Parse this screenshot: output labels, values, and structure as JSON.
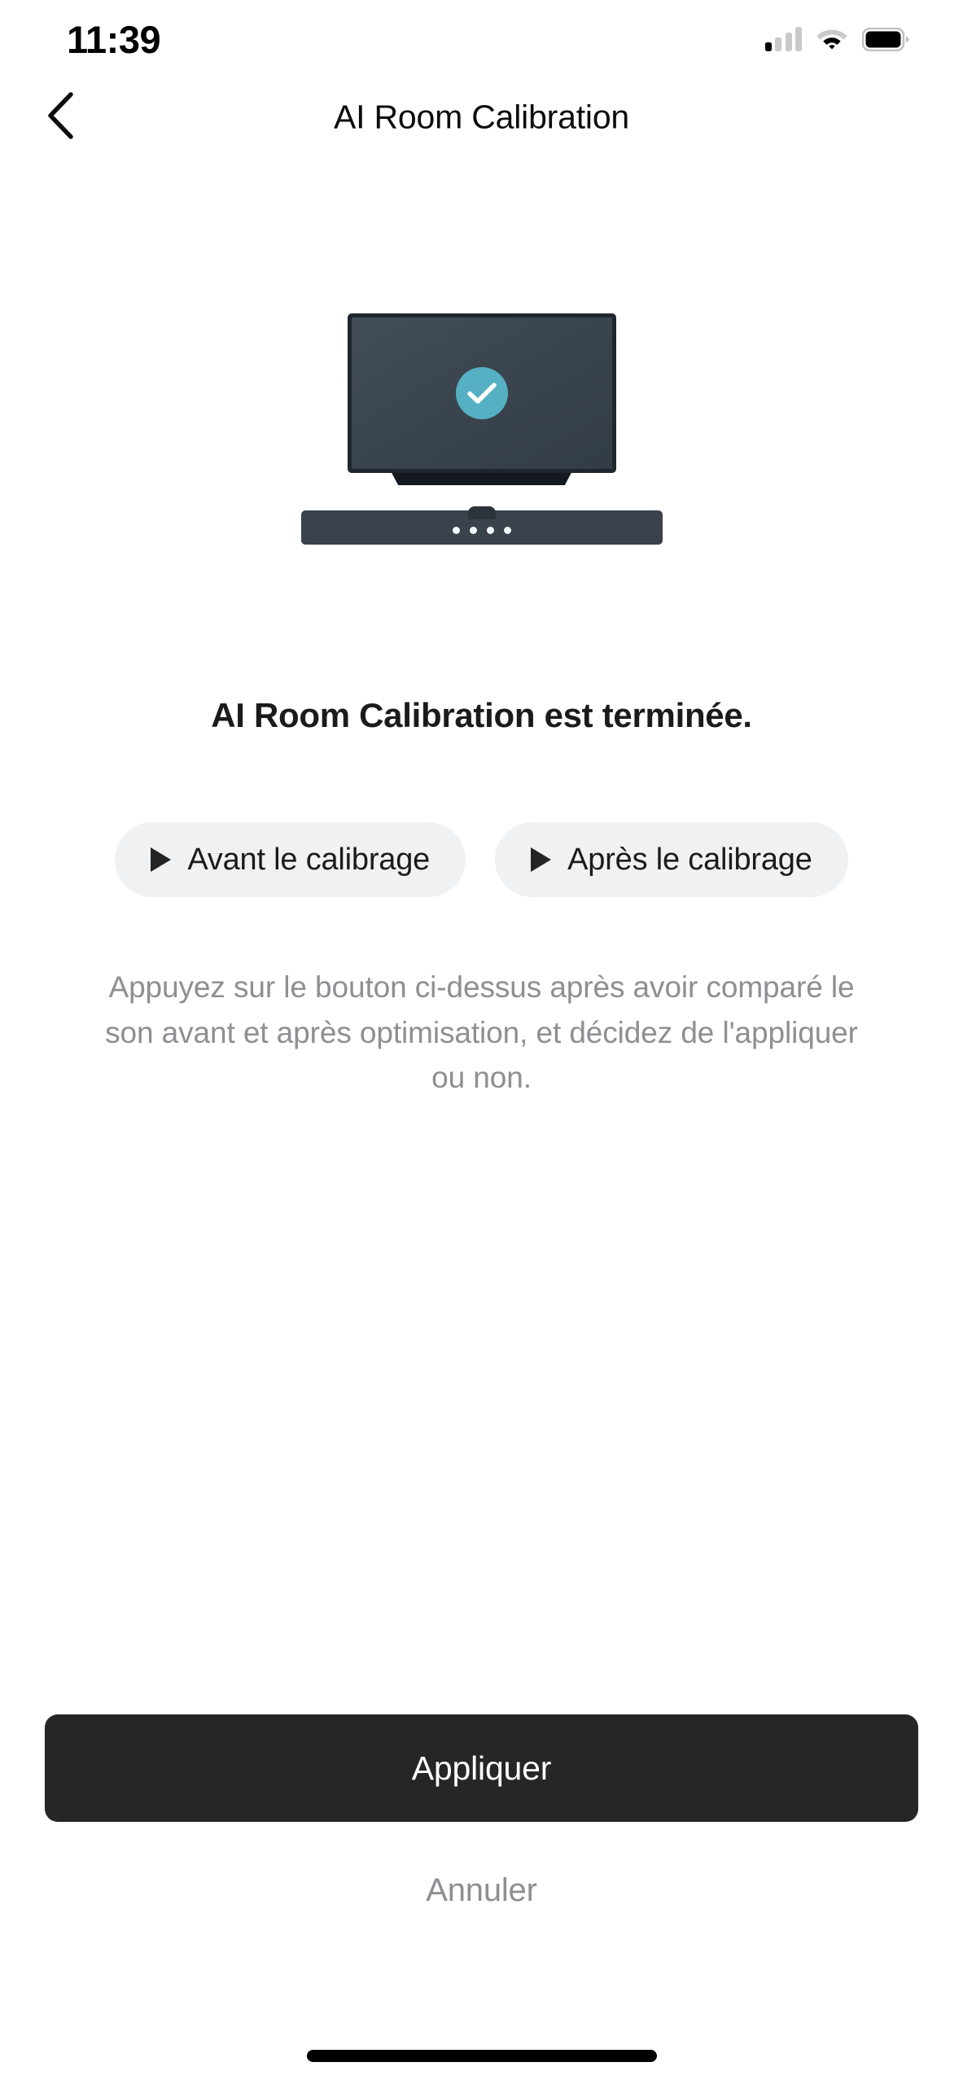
{
  "status_bar": {
    "time": "11:39",
    "cellular_icon": "cellular-signal-icon",
    "wifi_icon": "wifi-icon",
    "battery_icon": "battery-full-icon"
  },
  "nav": {
    "back_icon": "chevron-left-icon",
    "title": "AI Room Calibration"
  },
  "illustration": {
    "tv_name": "television-illustration",
    "status_icon": "check-circle-icon",
    "soundbar_name": "soundbar-illustration",
    "accent_color": "#56b0c4",
    "tv_screen_color": "#3b4550",
    "soundbar_color": "#3a424b",
    "led_count": 4
  },
  "main": {
    "headline": "AI Room Calibration est terminée.",
    "compare_buttons": [
      {
        "label": "Avant le calibrage",
        "icon": "play-icon"
      },
      {
        "label": "Après le calibrage",
        "icon": "play-icon"
      }
    ],
    "description": "Appuyez sur le bouton ci-dessus après avoir comparé le son avant et après optimisation, et décidez de l'appliquer ou non."
  },
  "footer": {
    "primary_label": "Appliquer",
    "secondary_label": "Annuler"
  }
}
